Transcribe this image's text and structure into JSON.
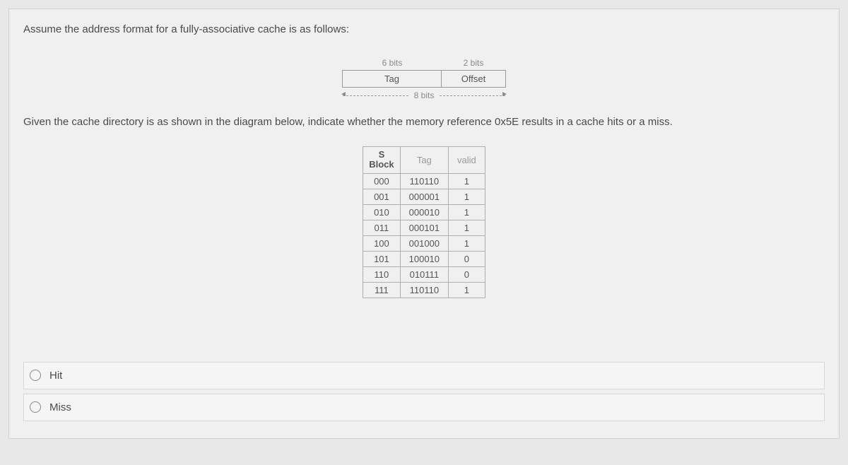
{
  "question": {
    "line1": "Assume the address format for a fully-associative cache is as follows:",
    "line2": "Given  the cache directory is as shown in the diagram below, indicate whether the  memory reference 0x5E results in a cache hits or a miss."
  },
  "address_format": {
    "bits_left": "6 bits",
    "bits_right": "2 bits",
    "tag_label": "Tag",
    "offset_label": "Offset",
    "total_bits": "8 bits"
  },
  "cache_table": {
    "headers": {
      "sblock": "S Block",
      "tag": "Tag",
      "valid": "valid"
    },
    "rows": [
      {
        "block": "000",
        "tag": "110110",
        "valid": "1"
      },
      {
        "block": "001",
        "tag": "000001",
        "valid": "1"
      },
      {
        "block": "010",
        "tag": "000010",
        "valid": "1"
      },
      {
        "block": "011",
        "tag": "000101",
        "valid": "1"
      },
      {
        "block": "100",
        "tag": "001000",
        "valid": "1"
      },
      {
        "block": "101",
        "tag": "100010",
        "valid": "0"
      },
      {
        "block": "110",
        "tag": "010111",
        "valid": "0"
      },
      {
        "block": "111",
        "tag": "110110",
        "valid": "1"
      }
    ]
  },
  "options": {
    "hit": "Hit",
    "miss": "Miss"
  }
}
